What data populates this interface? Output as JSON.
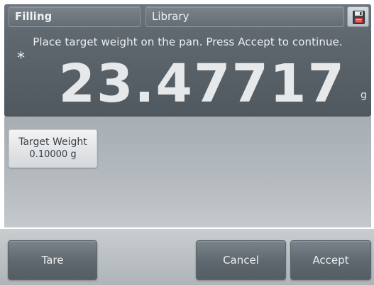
{
  "tabs": {
    "application": "Filling",
    "library": "Library"
  },
  "icons": {
    "save": "floppy-disk-icon",
    "stable": "asterisk-icon"
  },
  "prompt": "Place target weight on the pan.  Press Accept to continue.",
  "display": {
    "stable_indicator": "*",
    "reading": "23.47717",
    "unit": "g"
  },
  "target": {
    "label": "Target Weight",
    "value": "0.10000 g"
  },
  "buttons": {
    "tare": "Tare",
    "cancel": "Cancel",
    "accept": "Accept"
  },
  "colors": {
    "save_icon_accent": "#d23a3a"
  }
}
